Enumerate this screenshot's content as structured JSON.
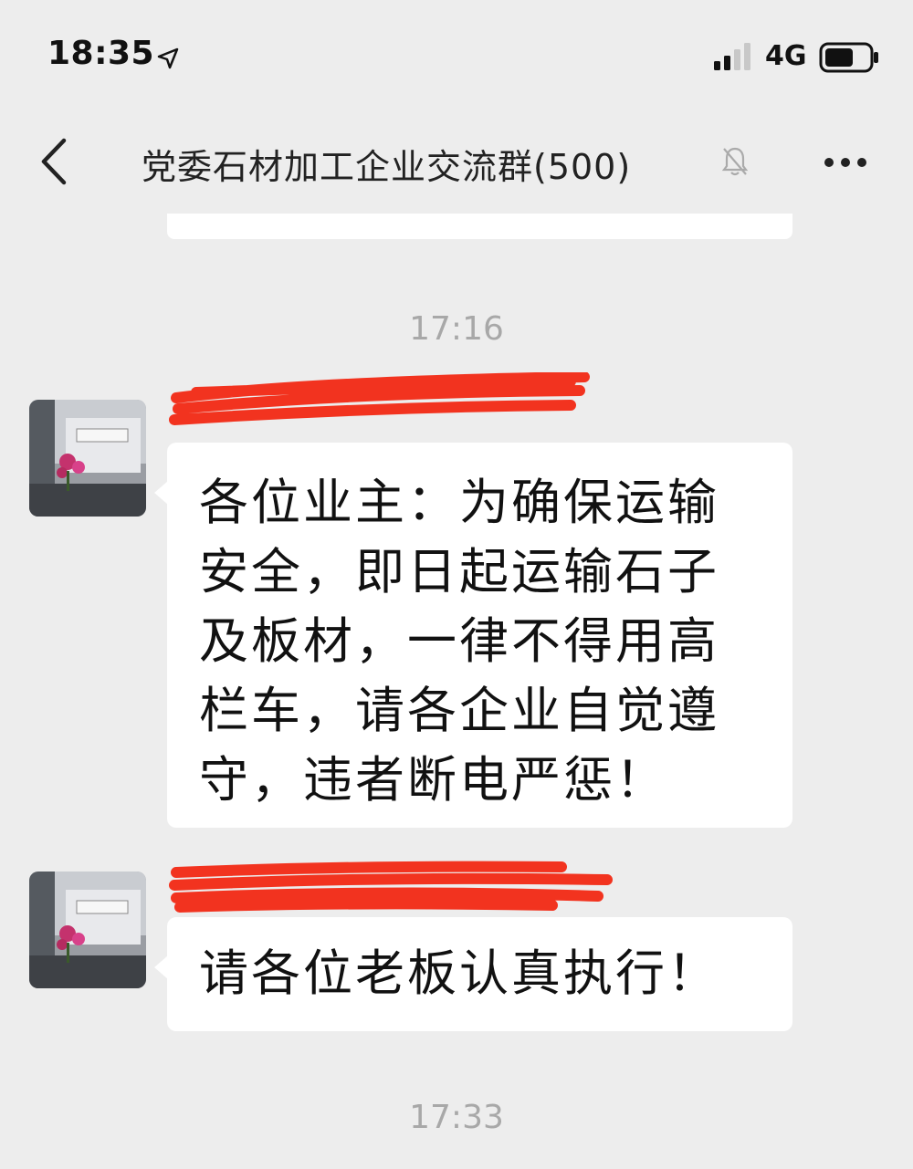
{
  "status_bar": {
    "time": "18:35",
    "network": "4G",
    "icons": [
      "location-arrow-icon",
      "signal-bars-icon",
      "battery-icon"
    ]
  },
  "header": {
    "title": "党委石材加工企业交流群(500)",
    "icons": [
      "back-chevron-icon",
      "mute-bell-icon",
      "more-dots-icon"
    ]
  },
  "timestamps": [
    "17:16",
    "17:33"
  ],
  "messages": [
    {
      "lines": [
        "各位业主：为确保运输",
        "安全，即日起运输石子",
        "及板材，一律不得用高",
        "栏车，请各企业自觉遵",
        "守，违者断电严惩！"
      ]
    },
    {
      "lines": [
        "请各位老板认真执行！"
      ]
    }
  ],
  "colors": {
    "background": "#ededed",
    "bubble": "#ffffff",
    "timestamp": "#a8a8a8",
    "redaction": "#f2331f"
  }
}
